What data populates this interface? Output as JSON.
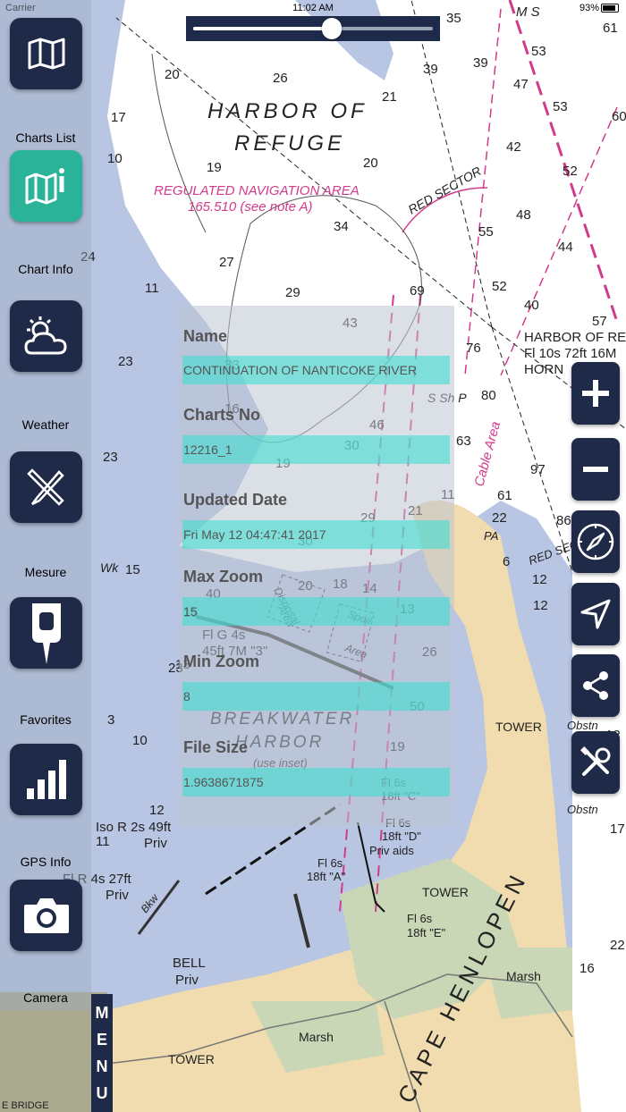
{
  "status_bar": {
    "carrier": "Carrier",
    "time": "11:02 AM",
    "battery": "93%"
  },
  "slider": {
    "value": 0.5
  },
  "sidebar": {
    "items": [
      {
        "label": "Charts List",
        "icon": "folded-map-icon"
      },
      {
        "label": "Chart Info",
        "icon": "map-info-icon"
      },
      {
        "label": "Weather",
        "icon": "sun-cloud-icon"
      },
      {
        "label": "Mesure",
        "icon": "ruler-pencil-icon"
      },
      {
        "label": "Favorites",
        "icon": "map-pin-icon"
      },
      {
        "label": "GPS Info",
        "icon": "signal-bars-icon"
      },
      {
        "label": "Camera",
        "icon": "camera-icon"
      }
    ],
    "menu_tab": [
      "M",
      "E",
      "N",
      "U"
    ]
  },
  "right_controls": [
    {
      "name": "zoom-in-button",
      "icon": "plus-icon"
    },
    {
      "name": "zoom-out-button",
      "icon": "minus-icon"
    },
    {
      "name": "compass-button",
      "icon": "compass-icon"
    },
    {
      "name": "locate-button",
      "icon": "navigation-arrow-icon"
    },
    {
      "name": "share-button",
      "icon": "share-icon"
    },
    {
      "name": "settings-button",
      "icon": "tools-icon"
    }
  ],
  "info_panel": {
    "name_label": "Name",
    "name_value": "CONTINUATION OF NANTICOKE RIVER",
    "charts_no_label": "Charts No",
    "charts_no_value": "12216_1",
    "updated_label": "Updated Date",
    "updated_value": "Fri May 12 04:47:41 2017",
    "max_zoom_label": "Max Zoom",
    "max_zoom_value": "15",
    "min_zoom_label": "Min Zoom",
    "min_zoom_value": "8",
    "file_size_label": "File Size",
    "file_size_value": "1.9638671875"
  },
  "map_labels": {
    "harbor_of": "HARBOR OF",
    "refuge": "REFUGE",
    "regulated": "REGULATED NAVIGATION AREA",
    "regulated_note": "165.510 (see note A)",
    "red_sector": "RED SECTOR",
    "harbor_light_1": "HARBOR OF REF",
    "harbor_light_2": "Fl 10s 72ft 16M",
    "harbor_light_3": "HORN",
    "cable_area": "Cable Area",
    "breakwater": "BREAKWATER",
    "harbor": "HARBOR",
    "use_inset": "(use inset)",
    "disposal": "Disposal",
    "area": "Area",
    "spoil": "Spoil",
    "spoil_area": "Area",
    "fl_g_1": "Fl G 4s",
    "fl_g_2": "45ft 7M \"3\"",
    "tower_1": "TOWER",
    "tower_2": "TOWER",
    "tower_3": "TOWER",
    "cape": "CAPE HENLOPEN",
    "marsh_1": "Marsh",
    "marsh_2": "Marsh",
    "bell_1": "BELL",
    "bell_2": "Priv",
    "iso_1": "Iso R 2s 49ft",
    "iso_2": "Priv",
    "flr_1": "Fl R 4s 27ft",
    "flr_2": "Priv",
    "bkw": "Bkw",
    "fl6c_1": "Fl 6s",
    "fl6c_2": "18ft \"C\"",
    "fl6d_1": "Fl 6s",
    "fl6d_2": "18ft \"D\"",
    "fl6d_3": "Priv aids",
    "fl6a_1": "Fl 6s",
    "fl6a_2": "18ft \"A\"",
    "fl6e_1": "Fl 6s",
    "fl6e_2": "18ft \"E\"",
    "s_sh_p": "S Sh P",
    "wk": "Wk",
    "red_sec_2": "RED SEC",
    "obstn_1": "Obstn",
    "obstn_2": "Obstn",
    "ms": "M S",
    "pa": "PA",
    "bridge": "E BRIDGE"
  },
  "soundings": [
    "35",
    "61",
    "53",
    "47",
    "53",
    "60",
    "39",
    "39",
    "20",
    "26",
    "21",
    "17",
    "10",
    "19",
    "20",
    "42",
    "52",
    "48",
    "34",
    "44",
    "27",
    "29",
    "69",
    "55",
    "52",
    "40",
    "57",
    "76",
    "80",
    "24",
    "11",
    "23",
    "43",
    "33",
    "16",
    "46",
    "30",
    "63",
    "97",
    "19",
    "23",
    "30",
    "29",
    "21",
    "11",
    "61",
    "86",
    "22",
    "12",
    "15",
    "15",
    "40",
    "20",
    "18",
    "14",
    "13",
    "12",
    "23",
    "26",
    "50",
    "13",
    "3",
    "10",
    "12",
    "11",
    "19",
    "12",
    "16",
    "22",
    "17",
    "6"
  ]
}
